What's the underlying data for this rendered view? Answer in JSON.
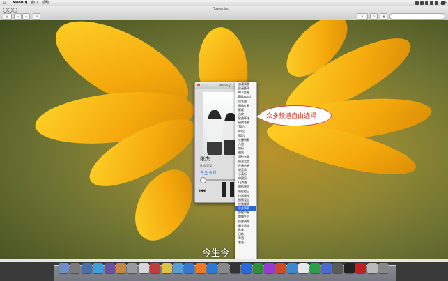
{
  "menubar": {
    "app_name": "MoonDJ",
    "menus": [
      "窗口",
      "帮助"
    ],
    "clock": "上午11:25"
  },
  "window": {
    "title": "flower.jpg"
  },
  "player": {
    "title": "MoonDJ",
    "artist": "张杰",
    "song": "这,就是爱",
    "album": "今生今世"
  },
  "channels": [
    "浪漫清晨",
    "民谣抒怀",
    "KTV金曲",
    "Billboard",
    "成名曲",
    "网络红歌",
    "影视",
    "古典",
    "欧美环球",
    "经典老歌",
    "70后",
    "80后",
    "90后",
    "火爆新歌",
    "儿歌",
    "旅行",
    "夜店",
    "流行无双",
    "摇滚之音",
    "民谣吟唱",
    "轻音乐",
    "小清新",
    "中国风",
    "Dj舞曲",
    "电影原声",
    "轻松假日",
    "快乐旅程",
    "甜蜜爱恋",
    "优美缓调",
    "单身情歌",
    "舒缓节奏",
    "慵懒午后",
    "伤感调频",
    "爵梦乐谈",
    "欧美",
    "日韩",
    "粤语",
    "看语"
  ],
  "selected_channel": "单身情歌",
  "bubble": {
    "text": "众多频道自由选择"
  },
  "caption": "今生今"
}
